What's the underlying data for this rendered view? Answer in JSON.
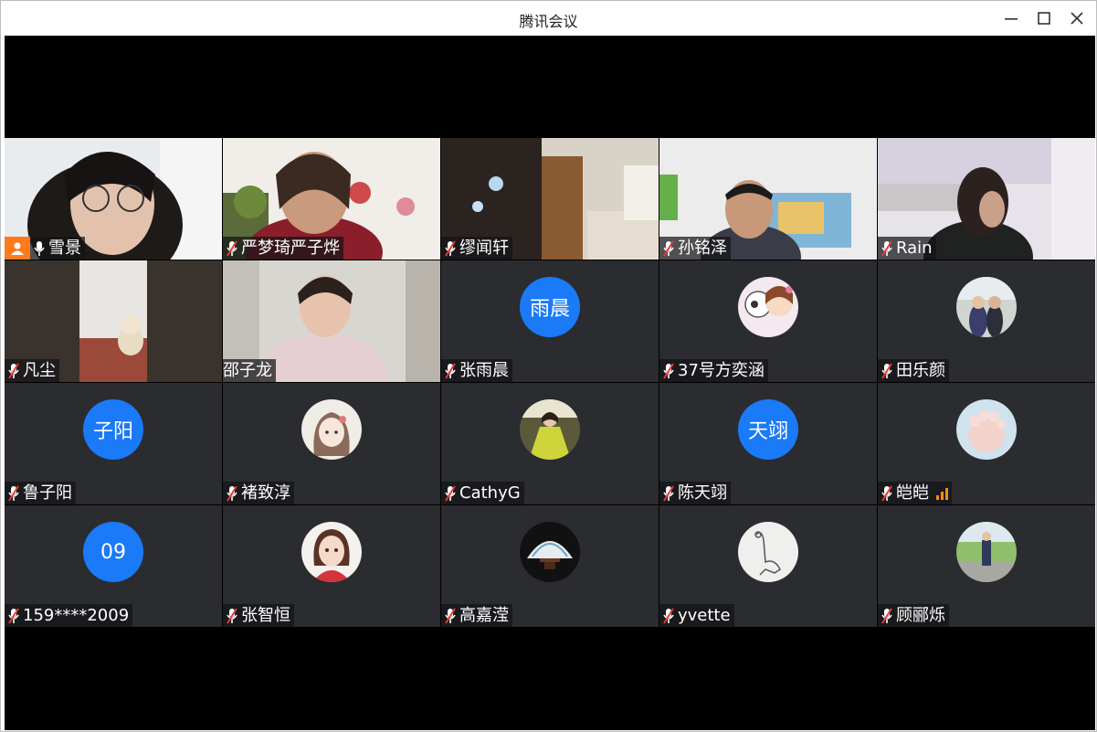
{
  "window": {
    "title": "腾讯会议"
  },
  "participants": [
    {
      "name": "雪景",
      "avatar_text": "",
      "host": true,
      "muted": false
    },
    {
      "name": "严梦琦严子烨",
      "avatar_text": "",
      "host": false,
      "muted": true
    },
    {
      "name": "缪闻轩",
      "avatar_text": "",
      "host": false,
      "muted": true
    },
    {
      "name": "孙铭泽",
      "avatar_text": "",
      "host": false,
      "muted": true
    },
    {
      "name": "Rain",
      "avatar_text": "",
      "host": false,
      "muted": true
    },
    {
      "name": "凡尘",
      "avatar_text": "",
      "host": false,
      "muted": true
    },
    {
      "name": "邵子龙",
      "avatar_text": "",
      "host": false,
      "muted": false
    },
    {
      "name": "张雨晨",
      "avatar_text": "雨晨",
      "host": false,
      "muted": true
    },
    {
      "name": "37号方奕涵",
      "avatar_text": "",
      "host": false,
      "muted": true
    },
    {
      "name": "田乐颜",
      "avatar_text": "",
      "host": false,
      "muted": true
    },
    {
      "name": "鲁子阳",
      "avatar_text": "子阳",
      "host": false,
      "muted": true
    },
    {
      "name": "褚致淳",
      "avatar_text": "",
      "host": false,
      "muted": true
    },
    {
      "name": "CathyG",
      "avatar_text": "",
      "host": false,
      "muted": true
    },
    {
      "name": "陈天翊",
      "avatar_text": "天翊",
      "host": false,
      "muted": true
    },
    {
      "name": "皑皑",
      "avatar_text": "",
      "host": false,
      "muted": true,
      "speaking": true
    },
    {
      "name": "159****2009",
      "avatar_text": "09",
      "host": false,
      "muted": true
    },
    {
      "name": "张智恒",
      "avatar_text": "",
      "host": false,
      "muted": true
    },
    {
      "name": "高嘉滢",
      "avatar_text": "",
      "host": false,
      "muted": true
    },
    {
      "name": "yvette",
      "avatar_text": "",
      "host": false,
      "muted": true
    },
    {
      "name": "顾郦烁",
      "avatar_text": "",
      "host": false,
      "muted": true
    }
  ],
  "colors": {
    "avatar_blue": "#1a7af8",
    "host_orange": "#ff7a1a",
    "tile_bg": "#2a2c30"
  }
}
